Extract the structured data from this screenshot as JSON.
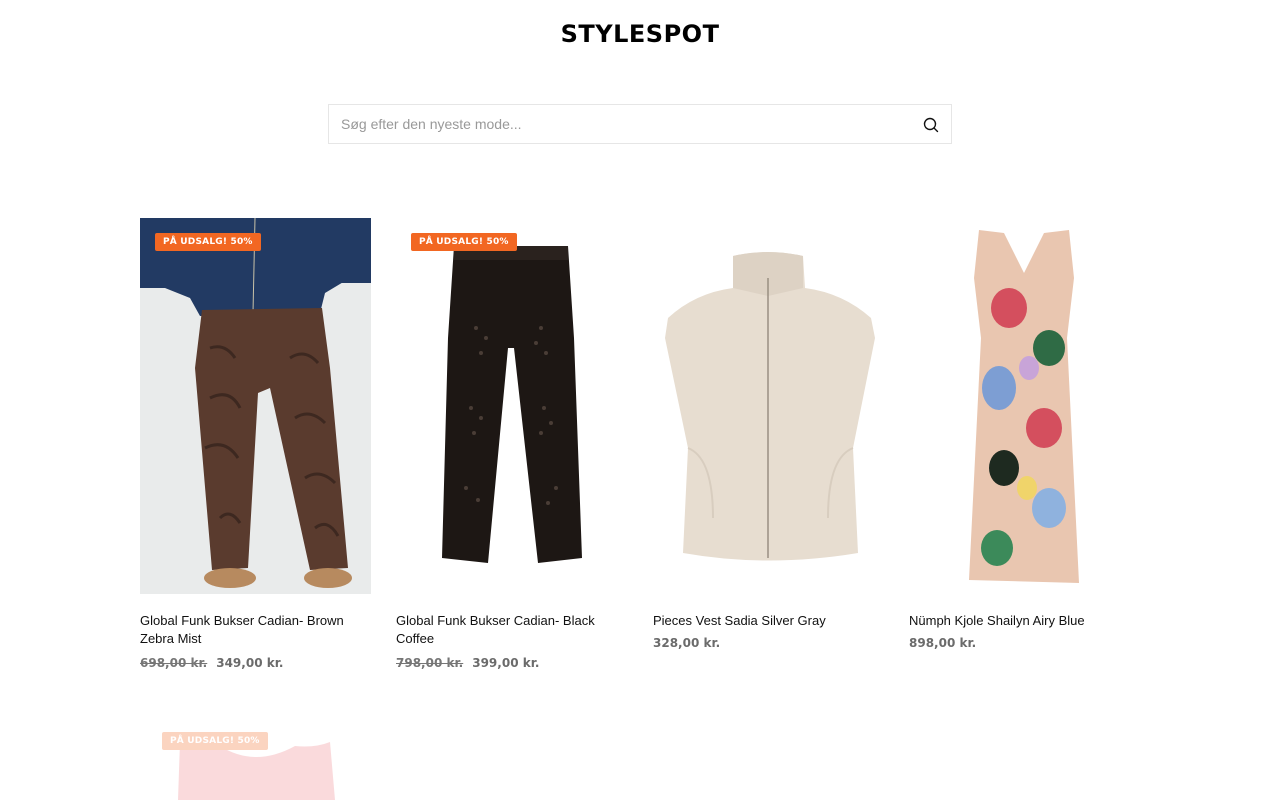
{
  "brand": "STYLESPOT",
  "search": {
    "placeholder": "Søg efter den nyeste mode..."
  },
  "products": [
    {
      "title": "Global Funk Bukser Cadian- Brown Zebra Mist",
      "badge": "PÅ UDSALG! 50%",
      "old_price": "698,00 kr.",
      "price": "349,00 kr."
    },
    {
      "title": "Global Funk Bukser Cadian- Black Coffee",
      "badge": "PÅ UDSALG! 50%",
      "old_price": "798,00 kr.",
      "price": "399,00 kr."
    },
    {
      "title": "Pieces Vest Sadia Silver Gray",
      "price": "328,00 kr."
    },
    {
      "title": "Nümph Kjole Shailyn Airy Blue",
      "price": "898,00 kr."
    },
    {
      "badge": "PÅ UDSALG! 50%"
    }
  ],
  "colors": {
    "badge": "#f26722",
    "price": "#767676"
  },
  "icons": {
    "search": "search-icon"
  }
}
